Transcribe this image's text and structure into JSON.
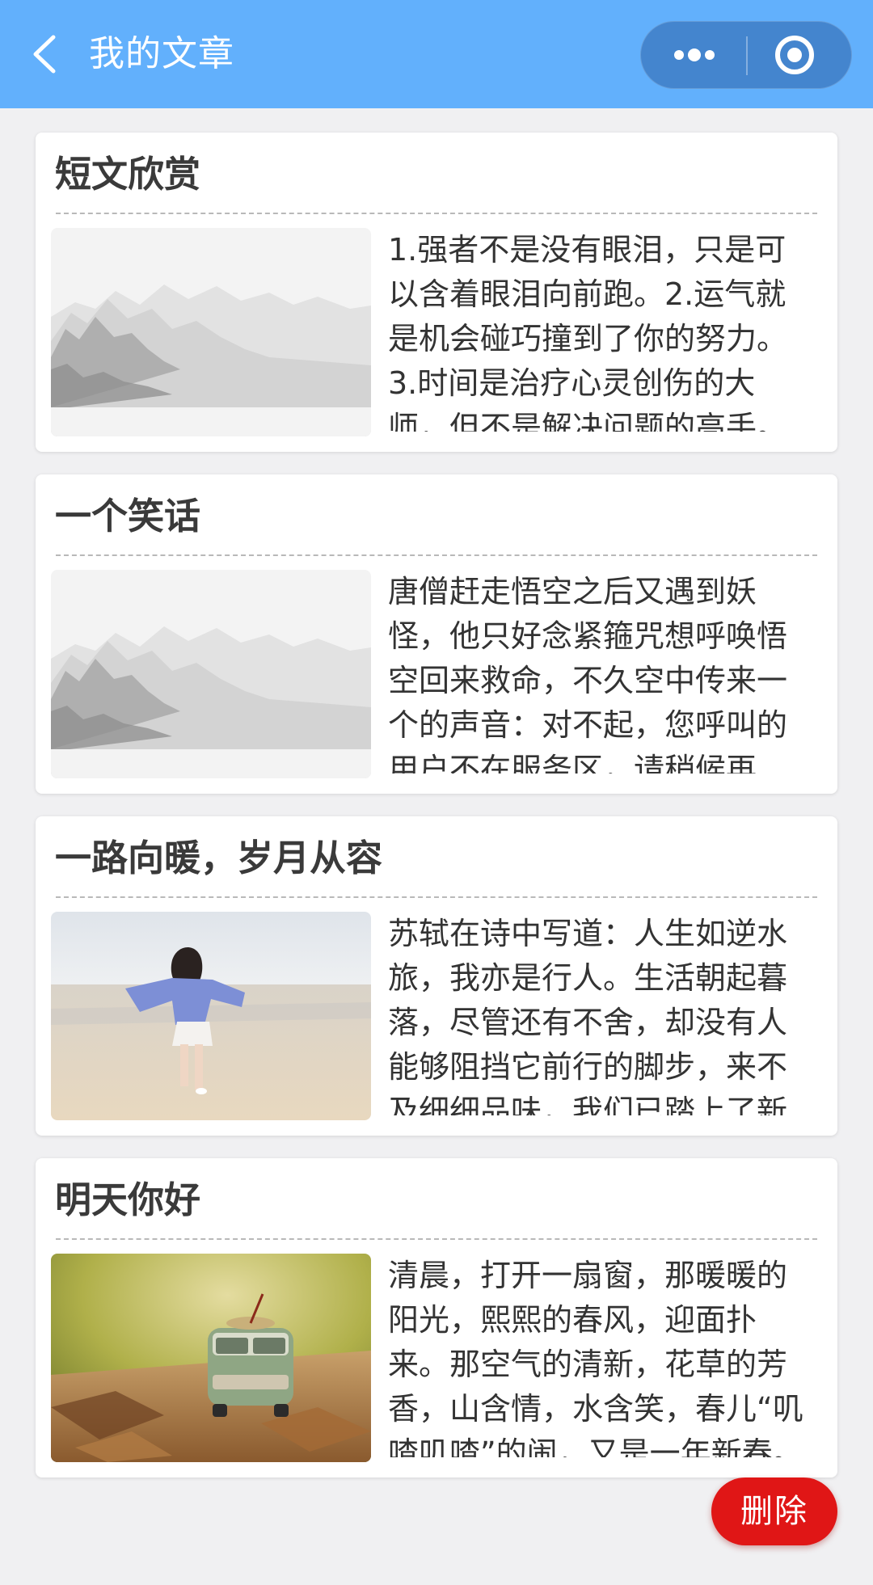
{
  "header": {
    "title": "我的文章",
    "back_icon": "chevron-left-icon",
    "more_icon": "more-dots-icon",
    "close_icon": "target-circle-icon",
    "background_color": "#62b0fc"
  },
  "articles": [
    {
      "title": "短文欣赏",
      "excerpt": "1.强者不是没有眼泪，只是可以含着眼泪向前跑。2.运气就是机会碰巧撞到了你的努力。3.时间是治疗心灵创伤的大师，但不是解决问题的高手。",
      "thumbnail": "ink-landscape-image"
    },
    {
      "title": "一个笑话",
      "excerpt": "唐僧赶走悟空之后又遇到妖怪，他只好念紧箍咒想呼唤悟空回来救命，不久空中传来一个的声音：对不起，您呼叫的用户不在服务区，请稍候再拨。",
      "thumbnail": "ink-landscape-image"
    },
    {
      "title": "一路向暖，岁月从容",
      "excerpt": "苏轼在诗中写道：人生如逆水旅，我亦是行人。生活朝起暮落，尽管还有不舍，却没有人能够阻挡它前行的脚步，来不及细细品味，我们已踏上了新的旅程。",
      "thumbnail": "beach-girl-image"
    },
    {
      "title": "明天你好",
      "excerpt": "清晨，打开一扇窗，那暖暖的阳光，熙熙的春风，迎面扑来。那空气的清新，花草的芳香，山含情，水含笑，春儿“叽喳叽喳”的闹，又是一年新春。",
      "thumbnail": "toy-van-image"
    }
  ],
  "actions": {
    "delete_label": "删除",
    "delete_color": "#e01616"
  }
}
